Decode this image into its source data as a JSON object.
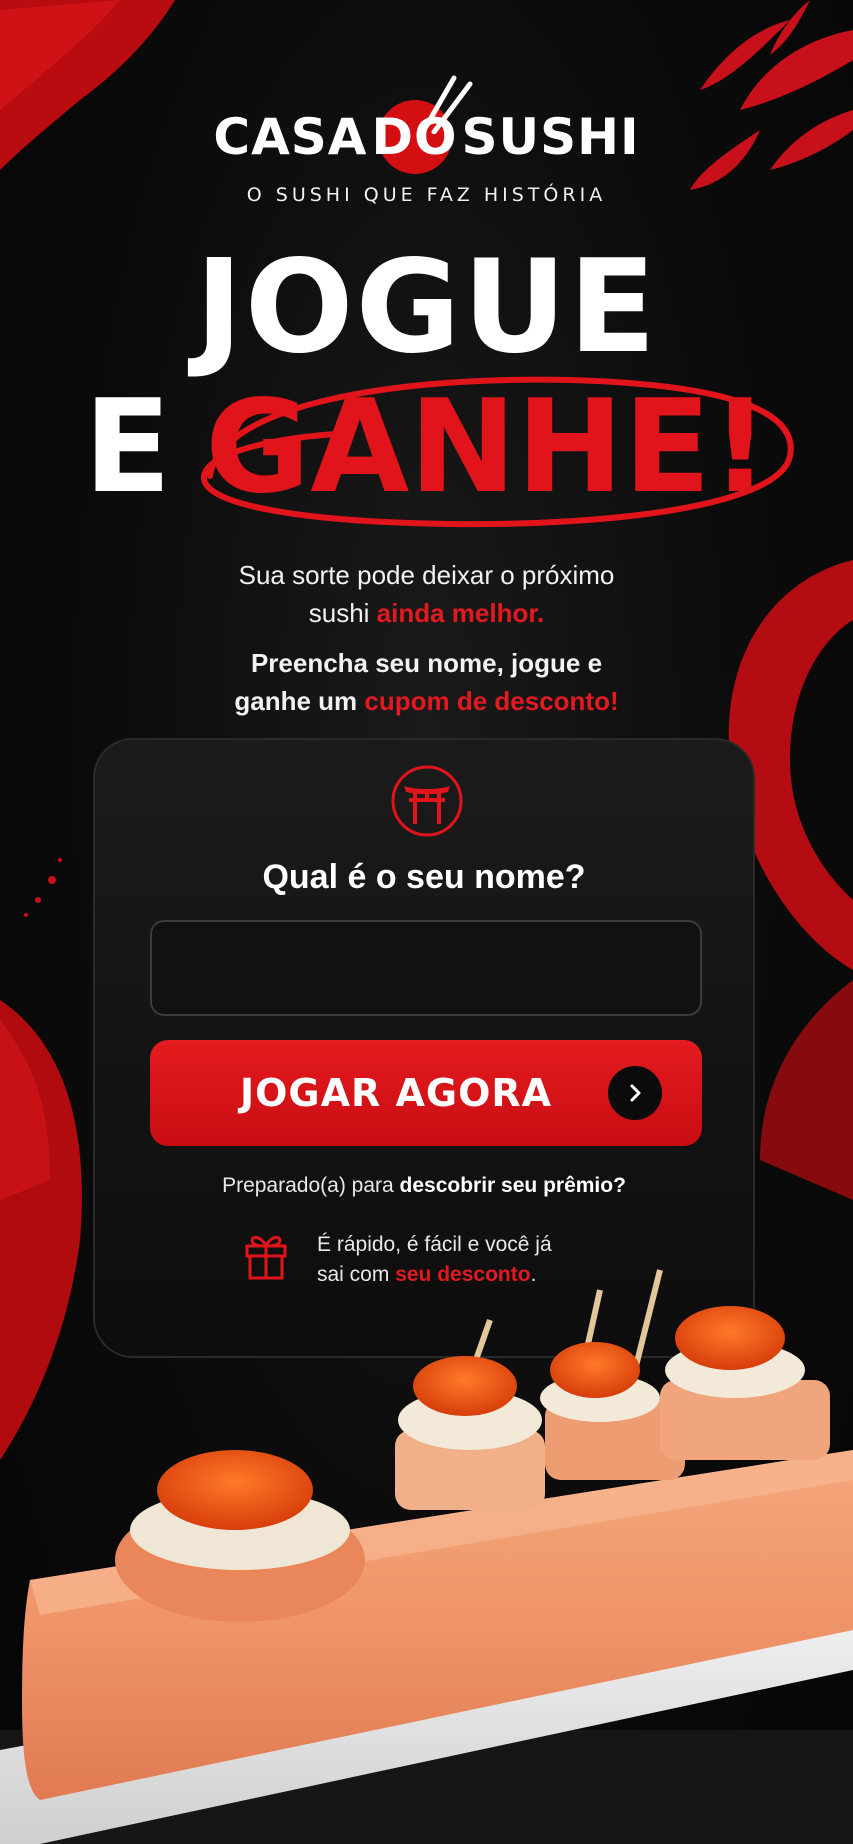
{
  "brand": {
    "name_left": "CASA",
    "name_do": "DO",
    "name_right": "SUSHI",
    "tagline": "O SUSHI QUE FAZ HISTÓRIA"
  },
  "headline": {
    "line1": "JOGUE",
    "line2_left": "E",
    "line2_right": "GANHE!"
  },
  "intro": {
    "line1": "Sua sorte pode deixar o próximo",
    "line2_plain": "sushi ",
    "line2_highlight": "ainda melhor.",
    "line3": "Preencha seu nome, jogue e",
    "line4_plain": "ganhe um ",
    "line4_highlight": "cupom de desconto!"
  },
  "form": {
    "question": "Qual é o seu nome?",
    "name_value": "",
    "name_placeholder": "",
    "button_label": "JOGAR AGORA",
    "ready_plain": "Preparado(a) para ",
    "ready_bold": "descobrir seu prêmio?",
    "gift_line1": "É rápido, é fácil e você já",
    "gift_line2_plain": "sai com ",
    "gift_line2_highlight": "seu desconto",
    "gift_line2_end": "."
  },
  "colors": {
    "accent": "#e0141a",
    "background": "#0a0a0a",
    "card": "#151515"
  },
  "icons": [
    "chopsticks-icon",
    "torii-gate-icon",
    "chevron-right-icon",
    "gift-icon"
  ]
}
